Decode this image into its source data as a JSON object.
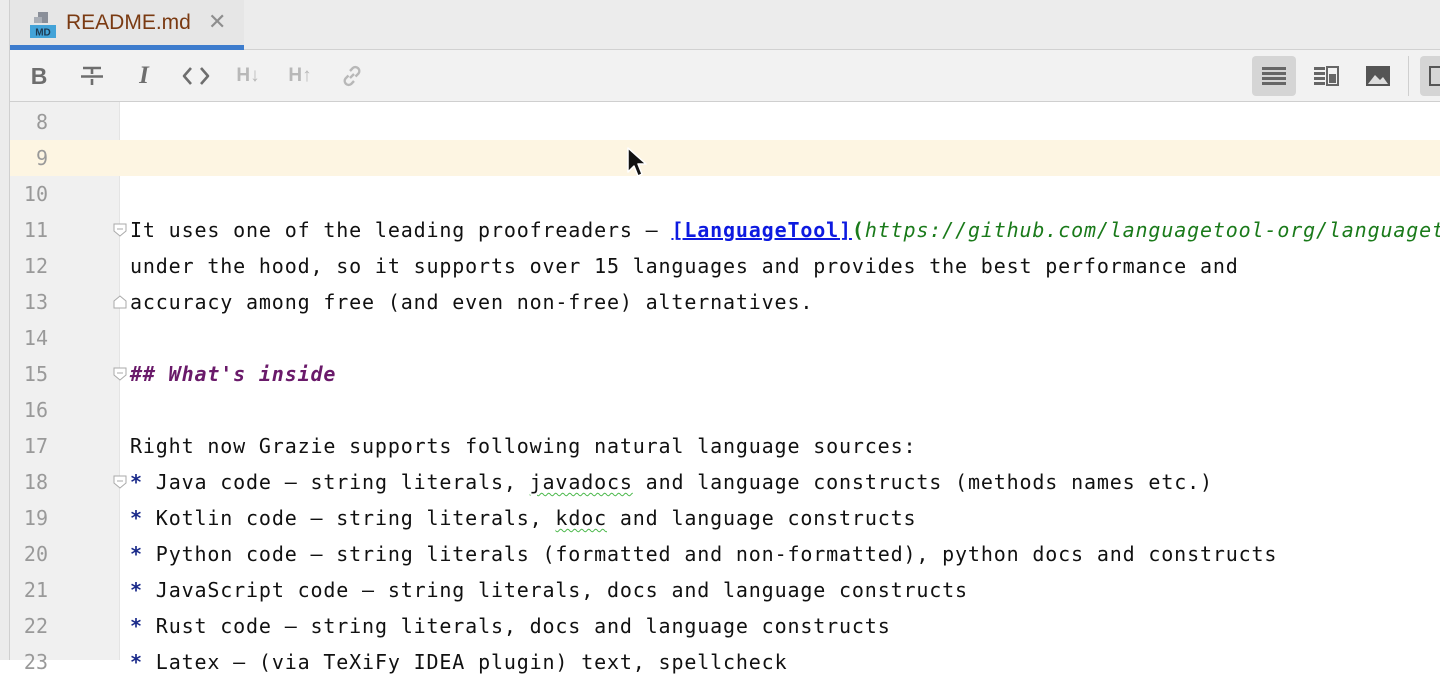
{
  "tab": {
    "icon": "md-file-icon",
    "icon_text": "MD",
    "title": "README.md",
    "close": "✕"
  },
  "toolbar": {
    "bold": "B",
    "strikethrough": "bold-strike",
    "italic": "I",
    "code": "code-icon",
    "header_down": "H↓",
    "header_up": "H↑",
    "link": "link-icon",
    "views": [
      "editor-only-icon",
      "split-view-icon",
      "preview-only-icon"
    ],
    "active_view": "editor-only-icon"
  },
  "editor": {
    "current_line": "9",
    "lines": [
      {
        "num": "8"
      },
      {
        "num": "9"
      },
      {
        "num": "10"
      },
      {
        "num": "11",
        "pre": "It uses one of the leading proofreaders – ",
        "link_text": "[LanguageTool]",
        "paren": "(",
        "url": "https://github.com/languagetool-org/languagetool"
      },
      {
        "num": "12",
        "text": "under the hood, so it supports over 15 languages and provides the best performance and"
      },
      {
        "num": "13",
        "text": "accuracy among free (and even non-free) alternatives."
      },
      {
        "num": "14"
      },
      {
        "num": "15",
        "heading": "## What's inside"
      },
      {
        "num": "16"
      },
      {
        "num": "17",
        "text": "Right now Grazie supports following natural language sources:"
      },
      {
        "num": "18",
        "bullet": "*",
        "pre": " Java code – string literals, ",
        "typo": "javadocs",
        "post": " and language constructs (methods names etc.)"
      },
      {
        "num": "19",
        "bullet": "*",
        "pre": " Kotlin code – string literals, ",
        "typo": "kdoc",
        "post": " and language constructs"
      },
      {
        "num": "20",
        "bullet": "*",
        "text": " Python code – string literals (formatted and non-formatted), python docs and constructs"
      },
      {
        "num": "21",
        "bullet": "*",
        "text": " JavaScript code – string literals, docs and language constructs"
      },
      {
        "num": "22",
        "bullet": "*",
        "text": " Rust code – string literals, docs and language constructs"
      },
      {
        "num": "23",
        "bullet": "*",
        "text": " Latex – (via TeXiFy IDEA plugin) text, spellcheck"
      }
    ]
  }
}
